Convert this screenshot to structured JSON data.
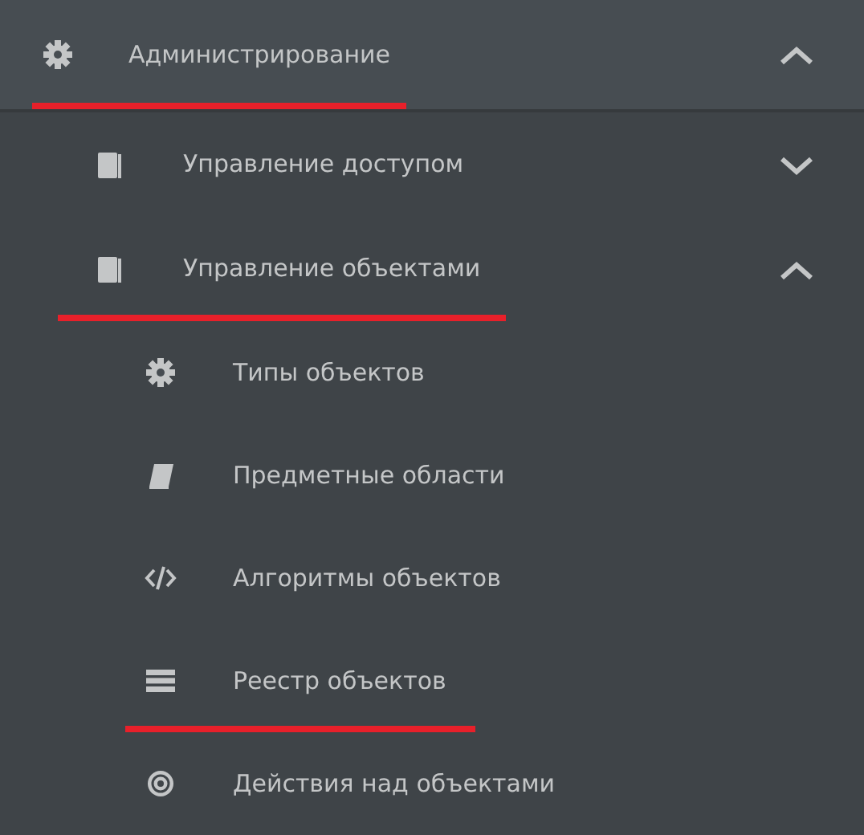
{
  "menu": [
    {
      "label": "Администрирование",
      "expanded": true,
      "highlighted": true,
      "children": [
        {
          "label": "Управление доступом",
          "expanded": false,
          "highlighted": false
        },
        {
          "label": "Управление объектами",
          "expanded": true,
          "highlighted": true,
          "children": [
            {
              "label": "Типы объектов",
              "highlighted": false
            },
            {
              "label": "Предметные области",
              "highlighted": false
            },
            {
              "label": "Алгоритмы объектов",
              "highlighted": false
            },
            {
              "label": "Реестр объектов",
              "highlighted": true
            },
            {
              "label": "Действия над объектами",
              "highlighted": false
            }
          ]
        }
      ]
    }
  ]
}
